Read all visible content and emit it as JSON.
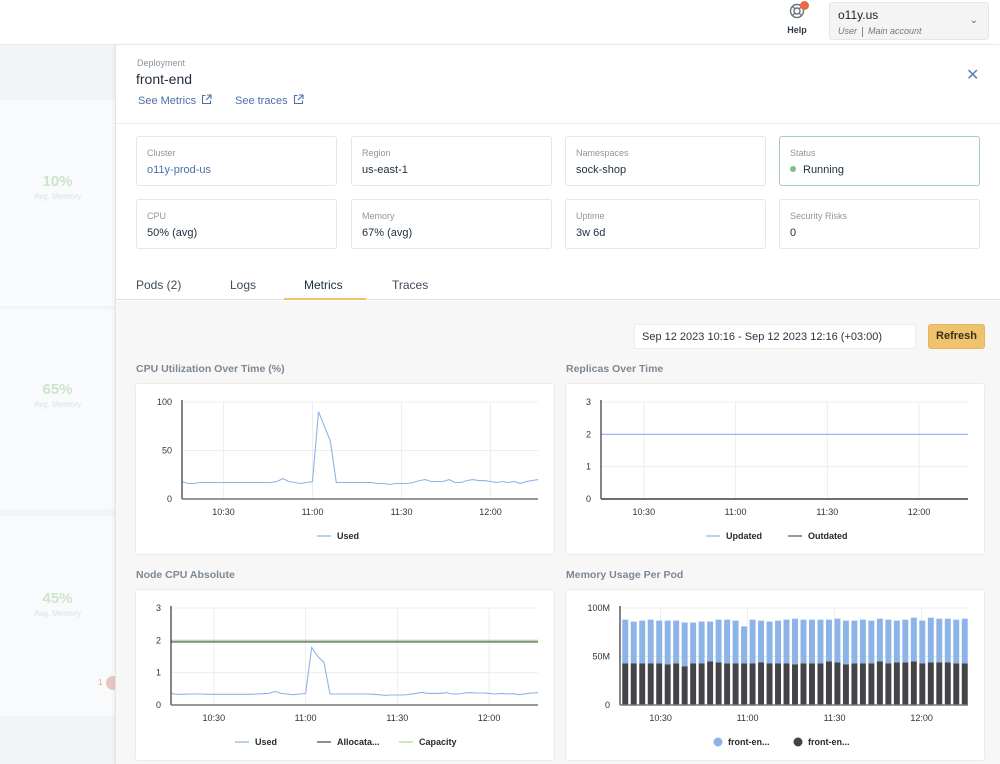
{
  "topbar": {
    "help_label": "Help",
    "help_icon": "lifebuoy-icon",
    "account": {
      "name": "o11y.us",
      "role": "User",
      "org": "Main account"
    }
  },
  "left_cards": [
    {
      "value": "10%",
      "label": "Avg. Memory"
    },
    {
      "value": "65%",
      "label": "Avg. Memory"
    },
    {
      "value": "45%",
      "label": "Avg. Memory"
    }
  ],
  "left_badge": "1",
  "panel": {
    "kind": "Deployment",
    "title": "front-end",
    "links": [
      "See Metrics",
      "See traces"
    ],
    "info": [
      {
        "label": "Cluster",
        "value": "o11y-prod-us"
      },
      {
        "label": "Region",
        "value": "us-east-1"
      },
      {
        "label": "Namespaces",
        "value": "sock-shop"
      },
      {
        "label": "Status",
        "value": "Running"
      },
      {
        "label": "CPU",
        "value": "50% (avg)"
      },
      {
        "label": "Memory",
        "value": "67% (avg)"
      },
      {
        "label": "Uptime",
        "value": "3w 6d"
      },
      {
        "label": "Security Risks",
        "value": "0"
      }
    ],
    "tabs": [
      "Pods (2)",
      "Logs",
      "Metrics",
      "Traces"
    ],
    "active_tab": "Metrics",
    "date_range": "Sep 12 2023 10:16 - Sep 12 2023 12:16 (+03:00)",
    "refresh_label": "Refresh"
  },
  "colors": {
    "accent": "#efc26e",
    "link": "#4d6fa8",
    "used": "#8db4e8",
    "dark": "#444448",
    "capacity": "#a8dc8c",
    "status_ok": "#7bbf8c"
  },
  "chart_data": [
    {
      "type": "line",
      "title": "CPU Utilization Over Time (%)",
      "x_ticks": [
        "10:30",
        "11:00",
        "11:30",
        "12:00"
      ],
      "x_tick_minutes": [
        30,
        60,
        90,
        120
      ],
      "x_range_minutes": [
        16,
        136
      ],
      "y_ticks": [
        "0",
        "50",
        "100"
      ],
      "ylim": [
        0,
        100
      ],
      "series": [
        {
          "name": "Used",
          "color": "#8db4e8",
          "x": [
            16,
            18,
            20,
            22,
            24,
            26,
            28,
            30,
            32,
            34,
            36,
            38,
            40,
            42,
            44,
            46,
            48,
            50,
            52,
            54,
            56,
            58,
            60,
            62,
            64,
            66,
            68,
            70,
            72,
            74,
            76,
            78,
            80,
            82,
            84,
            86,
            88,
            90,
            92,
            94,
            96,
            98,
            100,
            102,
            104,
            106,
            108,
            110,
            112,
            114,
            116,
            118,
            120,
            122,
            124,
            126,
            128,
            130,
            132,
            134,
            136
          ],
          "y": [
            18,
            16,
            16,
            17,
            17,
            17,
            17,
            17,
            17,
            17,
            17,
            17,
            17,
            17,
            17,
            17,
            18,
            21,
            18,
            17,
            16,
            17,
            18,
            90,
            75,
            60,
            17,
            17,
            17,
            17,
            17,
            17,
            17,
            16,
            16,
            15,
            16,
            16,
            16,
            17,
            19,
            20,
            18,
            18,
            18,
            20,
            17,
            17,
            19,
            20,
            19,
            19,
            18,
            17,
            18,
            17,
            18,
            16,
            18,
            19,
            20
          ]
        }
      ],
      "legend": [
        "Used"
      ]
    },
    {
      "type": "line",
      "title": "Replicas Over Time",
      "x_ticks": [
        "10:30",
        "11:00",
        "11:30",
        "12:00"
      ],
      "x_tick_minutes": [
        30,
        60,
        90,
        120
      ],
      "x_range_minutes": [
        16,
        136
      ],
      "y_ticks": [
        "0",
        "1",
        "2",
        "3"
      ],
      "ylim": [
        0,
        3
      ],
      "series": [
        {
          "name": "Updated",
          "color": "#8db4e8",
          "x": [
            16,
            136
          ],
          "y": [
            2,
            2
          ]
        },
        {
          "name": "Outdated",
          "color": "#555555",
          "x": [
            16,
            136
          ],
          "y": [
            0,
            0
          ]
        }
      ],
      "legend": [
        "Updated",
        "Outdated"
      ]
    },
    {
      "type": "line",
      "title": "Node CPU Absolute",
      "x_ticks": [
        "10:30",
        "11:00",
        "11:30",
        "12:00"
      ],
      "x_tick_minutes": [
        30,
        60,
        90,
        120
      ],
      "x_range_minutes": [
        16,
        136
      ],
      "y_ticks": [
        "0",
        "1",
        "2",
        "3"
      ],
      "ylim": [
        0,
        3
      ],
      "series": [
        {
          "name": "Used",
          "color": "#8db4e8",
          "x": [
            16,
            18,
            20,
            22,
            24,
            26,
            28,
            30,
            32,
            34,
            36,
            38,
            40,
            42,
            44,
            46,
            48,
            50,
            52,
            54,
            56,
            58,
            60,
            62,
            64,
            66,
            68,
            70,
            72,
            74,
            76,
            78,
            80,
            82,
            84,
            86,
            88,
            90,
            92,
            94,
            96,
            98,
            100,
            102,
            104,
            106,
            108,
            110,
            112,
            114,
            116,
            118,
            120,
            122,
            124,
            126,
            128,
            130,
            132,
            134,
            136
          ],
          "y": [
            0.36,
            0.33,
            0.33,
            0.34,
            0.34,
            0.34,
            0.33,
            0.33,
            0.33,
            0.33,
            0.33,
            0.33,
            0.33,
            0.33,
            0.34,
            0.35,
            0.36,
            0.42,
            0.36,
            0.34,
            0.32,
            0.34,
            0.36,
            1.78,
            1.5,
            1.32,
            0.34,
            0.34,
            0.34,
            0.34,
            0.34,
            0.34,
            0.34,
            0.33,
            0.32,
            0.3,
            0.31,
            0.31,
            0.31,
            0.33,
            0.36,
            0.39,
            0.36,
            0.36,
            0.36,
            0.38,
            0.34,
            0.34,
            0.37,
            0.38,
            0.37,
            0.37,
            0.36,
            0.34,
            0.36,
            0.34,
            0.35,
            0.32,
            0.35,
            0.37,
            0.38
          ]
        },
        {
          "name": "Allocatable",
          "color": "#444444",
          "x": [
            16,
            136
          ],
          "y": [
            1.95,
            1.95
          ]
        },
        {
          "name": "Capacity",
          "color": "#a8dc8c",
          "x": [
            16,
            136
          ],
          "y": [
            2.0,
            2.0
          ]
        }
      ],
      "legend": [
        "Used",
        "Allocata...",
        "Capacity"
      ]
    },
    {
      "type": "bar",
      "stacked": true,
      "title": "Memory Usage Per Pod",
      "x_ticks": [
        "10:30",
        "11:00",
        "11:30",
        "12:00"
      ],
      "x_tick_minutes": [
        30,
        60,
        90,
        120
      ],
      "x_range_minutes": [
        16,
        136
      ],
      "y_ticks": [
        "0",
        "50M",
        "100M"
      ],
      "ylim": [
        0,
        100
      ],
      "y_unit": "M",
      "series": [
        {
          "name": "front-en...",
          "color": "#444448",
          "values": [
            43,
            43,
            43,
            43,
            43,
            42,
            43,
            40,
            43,
            43,
            45,
            44,
            43,
            43,
            43,
            43,
            44,
            43,
            43,
            43,
            42,
            43,
            43,
            43,
            45,
            44,
            42,
            43,
            43,
            43,
            45,
            43,
            44,
            44,
            45,
            43,
            44,
            44,
            44,
            43,
            43
          ]
        },
        {
          "name": "front-en...",
          "color": "#8db4e8",
          "values": [
            45,
            43,
            44,
            45,
            44,
            45,
            44,
            45,
            42,
            43,
            41,
            44,
            45,
            44,
            38,
            45,
            43,
            43,
            44,
            45,
            47,
            45,
            45,
            45,
            43,
            45,
            45,
            44,
            45,
            44,
            44,
            45,
            43,
            44,
            45,
            44,
            46,
            45,
            45,
            45,
            46
          ]
        }
      ],
      "legend": [
        "front-en...",
        "front-en..."
      ]
    }
  ]
}
